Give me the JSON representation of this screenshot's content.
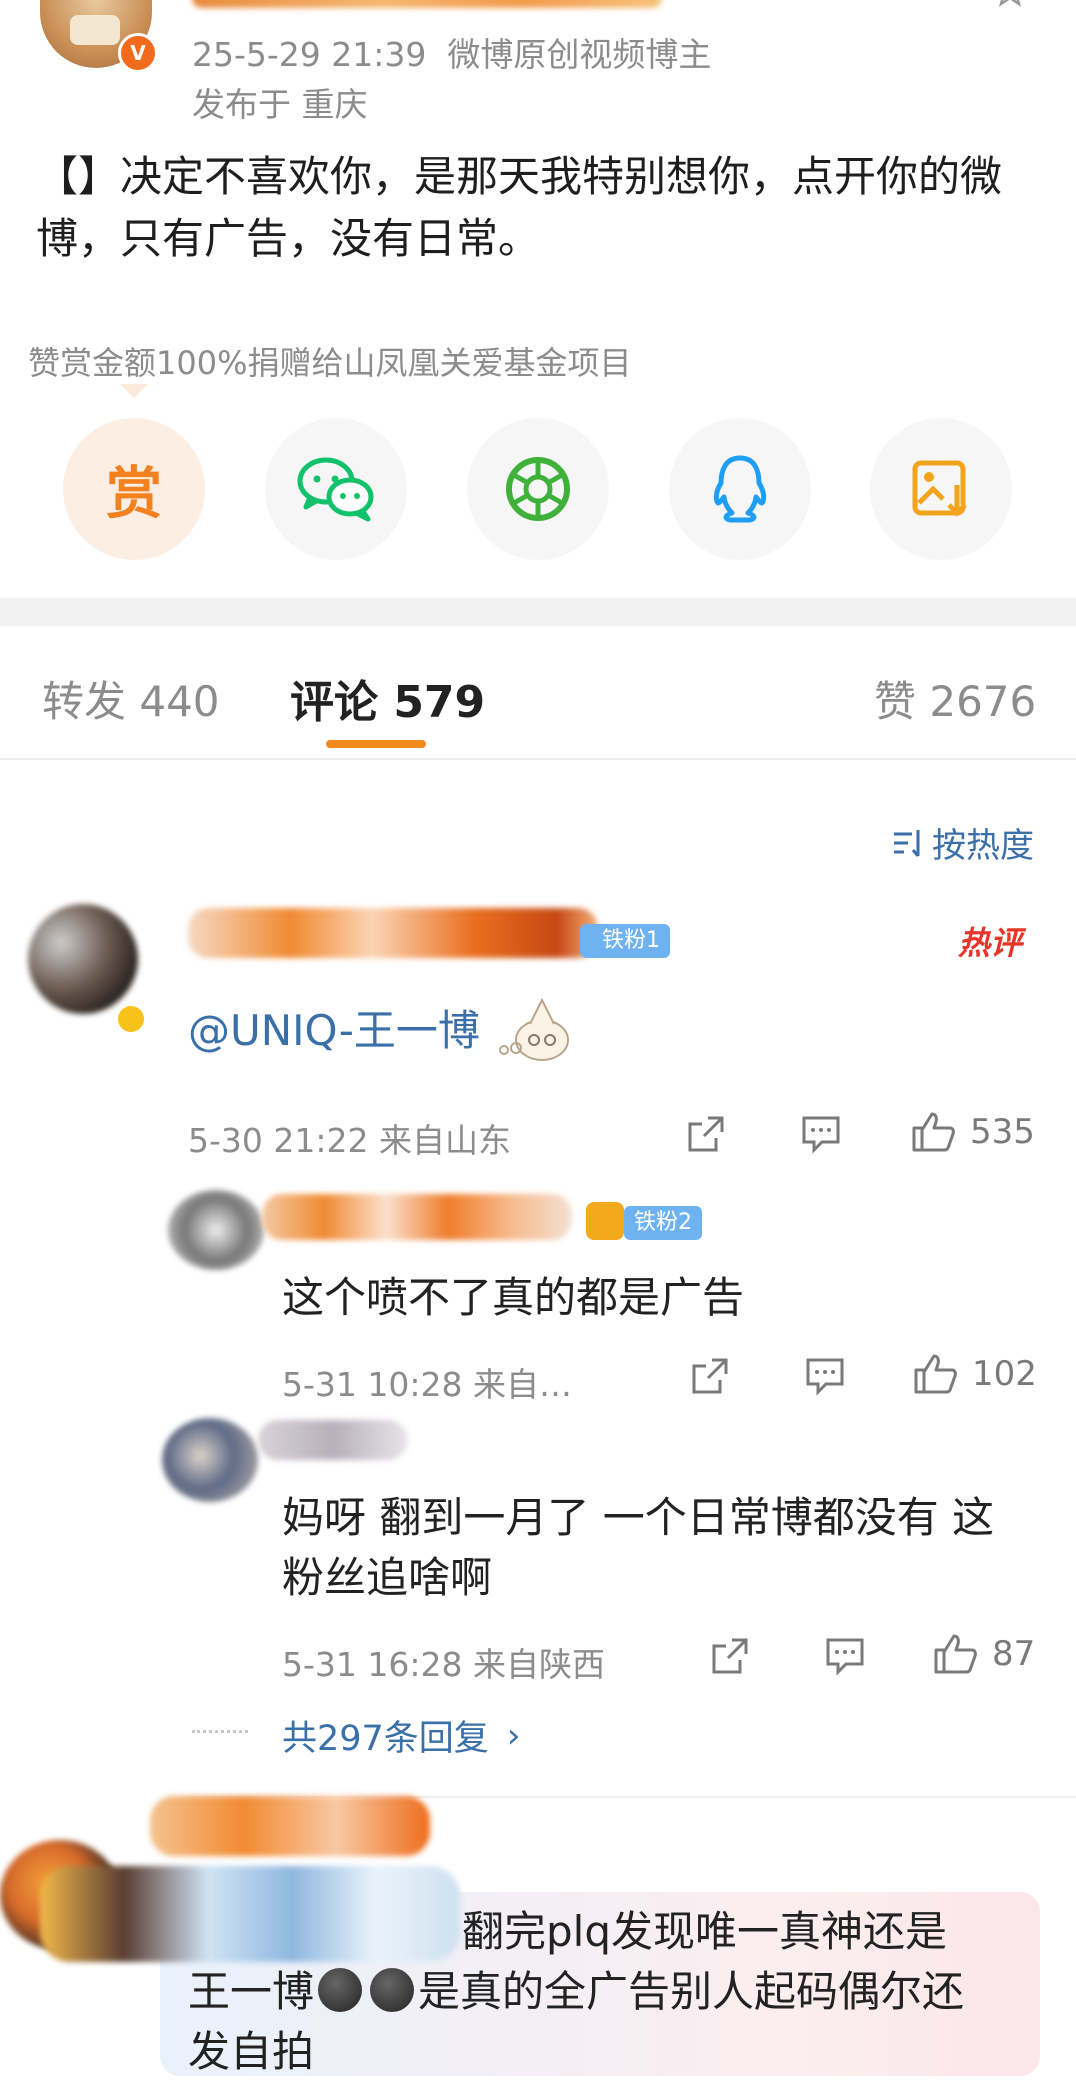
{
  "post": {
    "meta_time": "25-5-29 21:39",
    "meta_source": "微博原创视频博主",
    "location": "发布于 重庆",
    "text": "【】决定不喜欢你，是那天我特别想你，点开你的微博，只有广告，没有日常。"
  },
  "donation": {
    "note": "赞赏金额100%捐赠给山凤凰关爱基金项目",
    "reward_label": "赏"
  },
  "tabs": {
    "repost": "转发 440",
    "comments": "评论 579",
    "likes": "赞 2676"
  },
  "sort": {
    "label": "按热度"
  },
  "comments": [
    {
      "badge": "铁粉1",
      "hot_label": "热评",
      "text": "@UNIQ-王一博",
      "time": "5-30 21:22 来自山东",
      "likes": "535",
      "replies": [
        {
          "badge": "铁粉2",
          "text": "这个喷不了真的都是广告",
          "time": "5-31 10:28 来自…",
          "likes": "102"
        },
        {
          "text_line1": "妈呀 翻到一月了 一个日常博都没有 这",
          "text_line2": "粉丝追啥啊",
          "time": "5-31 16:28 来自陕西",
          "likes": "87"
        }
      ],
      "more_replies": "共297条回复"
    },
    {
      "line1": "翻完plq发现唯一真神还是",
      "line2_a": "王一博",
      "line2_b": "是真的全广告别人起码偶尔还",
      "line3": "发自拍"
    }
  ]
}
